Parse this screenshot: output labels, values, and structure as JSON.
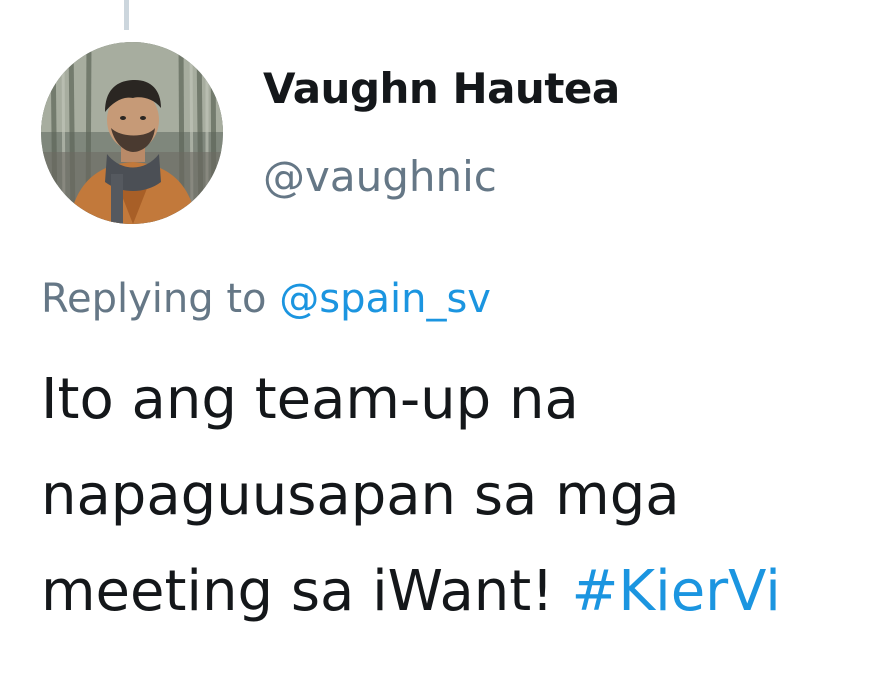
{
  "user": {
    "display_name": "Vaughn Hautea",
    "handle": "@vaughnic"
  },
  "reply": {
    "prefix": "Replying to",
    "mention": "@spain_sv"
  },
  "tweet": {
    "line1": "Ito ang team-up na",
    "line2": "napaguusapan sa mga",
    "line3_text": "meeting sa iWant!",
    "hashtag": "#KierVi"
  },
  "colors": {
    "text": "#14171a",
    "secondary": "#657786",
    "link": "#1b95e0",
    "thread_line": "#ccd6dd"
  },
  "icons": {
    "avatar": "profile-photo"
  }
}
